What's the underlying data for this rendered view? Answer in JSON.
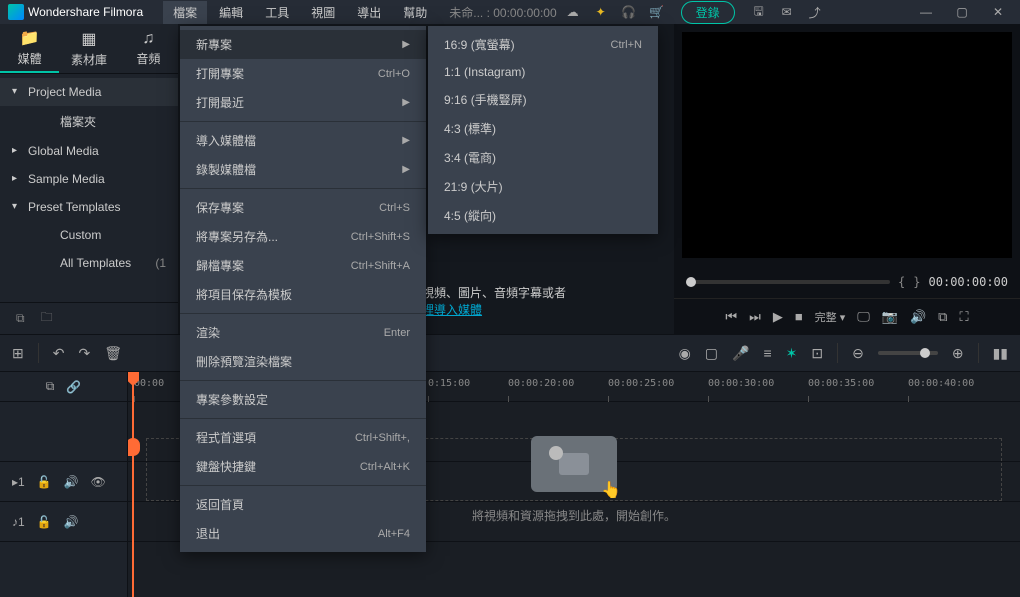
{
  "app": {
    "title": "Wondershare Filmora"
  },
  "menubar": [
    "檔案",
    "編輯",
    "工具",
    "視圖",
    "導出",
    "幫助"
  ],
  "title_status": "未命... : 00:00:00:00",
  "login": "登錄",
  "tabs": [
    {
      "label": "媒體",
      "active": true
    },
    {
      "label": "素材庫",
      "active": false
    },
    {
      "label": "音頻",
      "active": false
    }
  ],
  "tree": [
    {
      "label": "Project Media",
      "type": "parent",
      "selected": true,
      "arrow": "▾"
    },
    {
      "label": "檔案夾",
      "type": "child"
    },
    {
      "label": "Global Media",
      "type": "parent",
      "arrow": "▸"
    },
    {
      "label": "Sample Media",
      "type": "parent",
      "arrow": "▸"
    },
    {
      "label": "Preset Templates",
      "type": "parent",
      "arrow": "▾"
    },
    {
      "label": "Custom",
      "type": "child"
    },
    {
      "label": "All Templates",
      "type": "child",
      "count": "(1"
    }
  ],
  "content_hint_a": "視頻、圖片、音頻字幕或者",
  "content_hint_b": "裡導入媒體",
  "preview": {
    "left": "{",
    "right": "}",
    "time": "00:00:00:00",
    "quality": "完整 ▾"
  },
  "file_menu": [
    {
      "label": "新專案",
      "sub": true,
      "hover": true
    },
    {
      "label": "打開專案",
      "sc": "Ctrl+O"
    },
    {
      "label": "打開最近",
      "sub": true,
      "disabled": true
    },
    {
      "sep": true
    },
    {
      "label": "導入媒體檔",
      "sub": true
    },
    {
      "label": "錄製媒體檔",
      "sub": true
    },
    {
      "sep": true
    },
    {
      "label": "保存專案",
      "sc": "Ctrl+S"
    },
    {
      "label": "將專案另存為...",
      "sc": "Ctrl+Shift+S"
    },
    {
      "label": "歸檔專案",
      "sc": "Ctrl+Shift+A"
    },
    {
      "label": "將項目保存為模板",
      "disabled": true
    },
    {
      "sep": true
    },
    {
      "label": "渲染",
      "sc": "Enter",
      "disabled": true
    },
    {
      "label": "刪除預覽渲染檔案"
    },
    {
      "sep": true
    },
    {
      "label": "專案參數設定"
    },
    {
      "sep": true
    },
    {
      "label": "程式首選項",
      "sc": "Ctrl+Shift+,"
    },
    {
      "label": "鍵盤快捷鍵",
      "sc": "Ctrl+Alt+K"
    },
    {
      "sep": true
    },
    {
      "label": "返回首頁"
    },
    {
      "label": "退出",
      "sc": "Alt+F4"
    }
  ],
  "sub_menu": [
    {
      "label": "16:9 (寬螢幕)",
      "sc": "Ctrl+N"
    },
    {
      "label": "1:1 (Instagram)"
    },
    {
      "label": "9:16 (手機豎屏)"
    },
    {
      "label": "4:3 (標準)"
    },
    {
      "label": "3:4 (電商)"
    },
    {
      "label": "21:9 (大片)"
    },
    {
      "label": "4:5 (縱向)"
    }
  ],
  "timeline": {
    "ticks": [
      "00:00",
      "0:15:00",
      "00:00:20:00",
      "00:00:25:00",
      "00:00:30:00",
      "00:00:35:00",
      "00:00:40:00"
    ],
    "drop_hint": "將視頻和資源拖拽到此處，開始創作。"
  }
}
